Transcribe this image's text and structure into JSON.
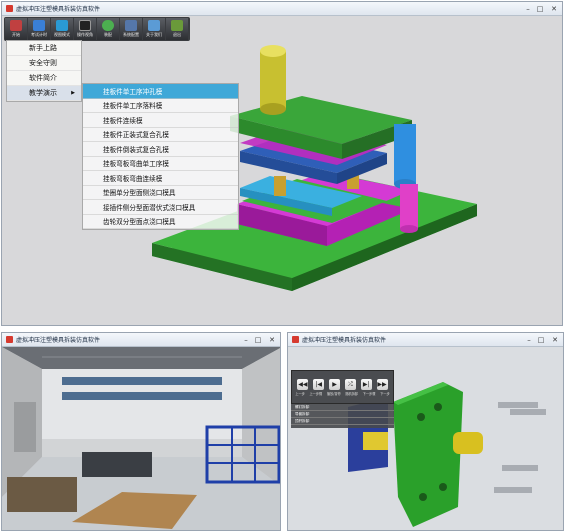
{
  "main_window": {
    "title": "虚拟冲压注塑模具拆装仿真软件",
    "toolbar": [
      {
        "label": "开始",
        "icon": "start-icon",
        "color": "#c04040"
      },
      {
        "label": "考试计时",
        "icon": "exam-icon",
        "color": "#3a7fd6"
      },
      {
        "label": "视图模式",
        "icon": "view-icon",
        "color": "#2a9ad4"
      },
      {
        "label": "操作视角",
        "icon": "camera-icon",
        "color": "#333333"
      },
      {
        "label": "装配",
        "icon": "assemble-icon",
        "color": "#4caf50"
      },
      {
        "label": "系统配置",
        "icon": "settings-icon",
        "color": "#5577aa"
      },
      {
        "label": "关于我们",
        "icon": "about-icon",
        "color": "#5b9bd5"
      },
      {
        "label": "退出",
        "icon": "exit-icon",
        "color": "#6a9a3a"
      }
    ],
    "menu": {
      "items": [
        {
          "label": "新手上路"
        },
        {
          "label": "安全守则"
        },
        {
          "label": "软件简介"
        },
        {
          "label": "教学演示",
          "has_submenu": true
        }
      ],
      "submenu": [
        {
          "label": "挂板件单工序冲孔模",
          "highlighted": true
        },
        {
          "label": "挂板件单工序落料模"
        },
        {
          "label": "挂板件连续模"
        },
        {
          "label": "挂板件正装式复合孔模"
        },
        {
          "label": "挂板件倒装式复合孔模"
        },
        {
          "label": "挂板弯板弯曲单工序模"
        },
        {
          "label": "挂板弯板弯曲连续模"
        },
        {
          "label": "垫圈单分型面侧浇口模具"
        },
        {
          "label": "接插件侧分型面潜伏式浇口模具"
        },
        {
          "label": "齿轮双分型面点浇口模具"
        }
      ]
    }
  },
  "scene_window": {
    "title": "虚拟冲压注塑模具拆装仿真软件"
  },
  "viewer_window": {
    "title": "虚拟冲压注塑模具拆装仿真软件",
    "player_buttons": [
      {
        "label": "上一步",
        "glyph": "◀◀"
      },
      {
        "label": "上一步骤",
        "glyph": "|◀"
      },
      {
        "label": "播放/暂停",
        "glyph": "▶"
      },
      {
        "label": "随机拆卸",
        "glyph": "⤮"
      },
      {
        "label": "下一步骤",
        "glyph": "▶|"
      },
      {
        "label": "下一步",
        "glyph": "▶▶"
      }
    ],
    "info_rows": [
      "螺钉拆卸",
      "导套拆卸",
      "顶杆拆卸"
    ]
  },
  "colors": {
    "highlight": "#3fa8d8",
    "mold_green": "#3aa63a",
    "mold_blue": "#2f5fb8",
    "mold_magenta": "#c02ac0"
  }
}
